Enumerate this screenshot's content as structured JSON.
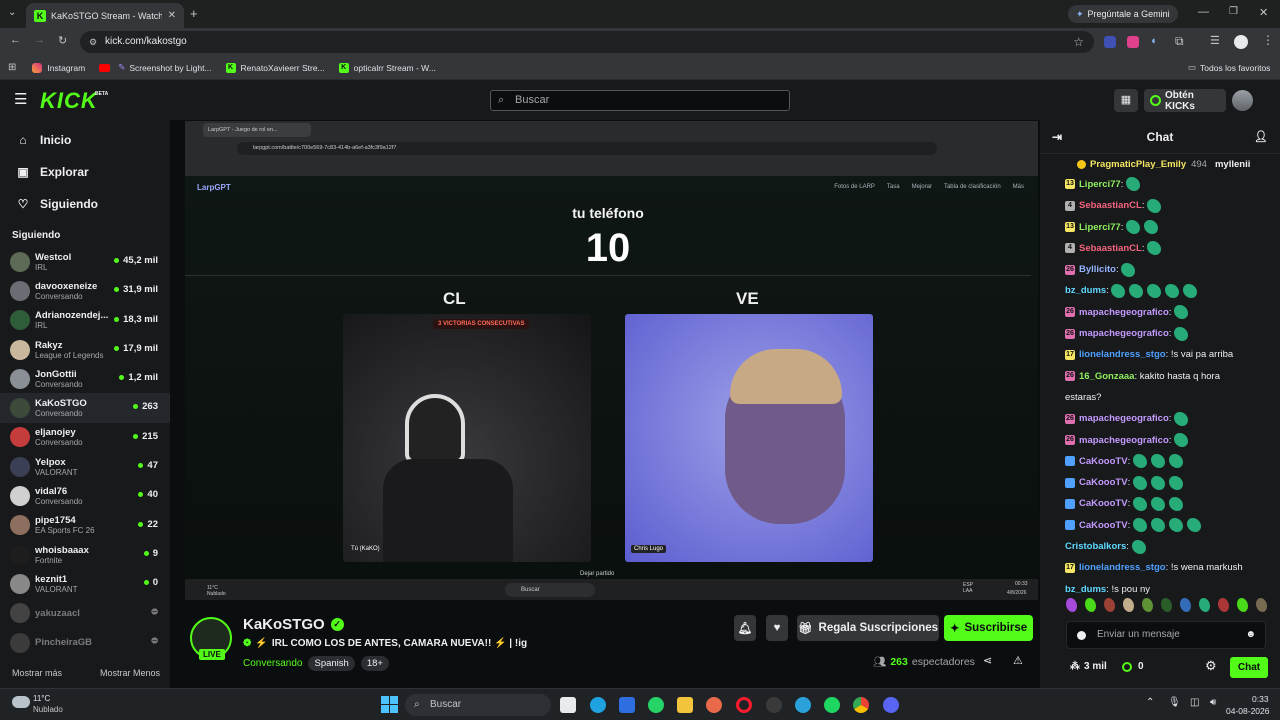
{
  "browser": {
    "tab_title": "KaKoSTGO Stream - Watch Live",
    "url": "kick.com/kakostgo",
    "gemini_label": "Pregúntale a Gemini",
    "bookmarks": [
      "Instagram",
      "Screenshot by Light...",
      "RenatoXavieerr Stre...",
      "opticalrr Stream - W..."
    ],
    "all_bookmarks": "Todos los favoritos"
  },
  "header": {
    "logo": "KICK",
    "beta": "BETA",
    "search_placeholder": "Buscar",
    "kicks_button": "Obtén KICKs"
  },
  "sidebar": {
    "nav": [
      {
        "label": "Inicio",
        "icon": "home-icon"
      },
      {
        "label": "Explorar",
        "icon": "compass-icon"
      },
      {
        "label": "Siguiendo",
        "icon": "heart-icon"
      }
    ],
    "following_heading": "Siguiendo",
    "following": [
      {
        "name": "Westcol",
        "category": "IRL",
        "viewers": "45,2 mil",
        "color": "#5b6b55"
      },
      {
        "name": "davooxeneize",
        "category": "Conversando",
        "viewers": "31,9 mil",
        "color": "#6a6e74"
      },
      {
        "name": "Adrianozendej...",
        "category": "IRL",
        "viewers": "18,3 mil",
        "color": "#2f5c3a"
      },
      {
        "name": "Rakyz",
        "category": "League of Legends",
        "viewers": "17,9 mil",
        "color": "#c9b89e"
      },
      {
        "name": "JonGottii",
        "category": "Conversando",
        "viewers": "1,2 mil",
        "color": "#8a8f96"
      },
      {
        "name": "KaKoSTGO",
        "category": "Conversando",
        "viewers": "263",
        "color": "#3d4a3a"
      },
      {
        "name": "eljanojey",
        "category": "Conversando",
        "viewers": "215",
        "color": "#c43c3c"
      },
      {
        "name": "Yelpox",
        "category": "VALORANT",
        "viewers": "47",
        "color": "#3a3f55"
      },
      {
        "name": "vidal76",
        "category": "Conversando",
        "viewers": "40",
        "color": "#d0d0d0"
      },
      {
        "name": "pipe1754",
        "category": "EA Sports FC 26",
        "viewers": "22",
        "color": "#8c6f5e"
      },
      {
        "name": "whoisbaaax",
        "category": "Fortnite",
        "viewers": "9",
        "color": "#1d1d1d"
      },
      {
        "name": "keznit1",
        "category": "VALORANT",
        "viewers": "0",
        "color": "#888888"
      },
      {
        "name": "yakuzaacl",
        "category": "",
        "viewers": "",
        "color": "#777777"
      },
      {
        "name": "PincheiraGB",
        "category": "",
        "viewers": "",
        "color": "#666666"
      }
    ],
    "show_more": "Mostrar más",
    "show_less": "Mostrar Menos"
  },
  "video": {
    "inner_tab": "LarpGPT - Juego de rol en...",
    "inner_url": "larpgpt.com/battle/c700e569-7c83-414b-a6ef-a3fc3f9a12f7",
    "site_name": "LarpGPT",
    "site_nav": [
      "Fotos de LARP",
      "Tasa",
      "Mejorar",
      "Tabla de clasificación",
      "Más"
    ],
    "your_phone": "tu teléfono",
    "count": "10",
    "left_team": "CL",
    "right_team": "VE",
    "streak": "3 VICTORIAS CONSECUTIVAS",
    "left_player": "Tú (KaKO)",
    "right_player": "Chris Lugo",
    "leave": "Dejar partido",
    "inner_weather": "11°C Nublado",
    "inner_search": "Buscar",
    "inner_lang": "ESP LAA",
    "inner_time": "00:33",
    "inner_date": "4/8/2026"
  },
  "stream": {
    "channel": "KaKoSTGO",
    "live_badge": "LIVE",
    "title": "IRL COMO LOS DE ANTES, CAMARA NUEVA!! ⚡ | !ig",
    "category": "Conversando",
    "tags": [
      "Spanish",
      "18+"
    ],
    "gift_button": "Regala Suscripciones",
    "subscribe_button": "Suscribirse",
    "viewers": "263",
    "viewers_label": "espectadores"
  },
  "chat": {
    "title": "Chat",
    "pinned_user": "PragmaticPlay_Emily",
    "pinned_count": "494",
    "pinned_user2": "myllenii",
    "messages": [
      {
        "badge": "13",
        "badge_color": "#f5e663",
        "user": "Liperci77",
        "color": "#8ef05e",
        "text": "",
        "emotes": 1
      },
      {
        "badge": "4",
        "badge_color": "#b0b0b0",
        "user": "SebaastianCL",
        "color": "#f4647f",
        "text": "",
        "emotes": 1
      },
      {
        "badge": "13",
        "badge_color": "#f5e663",
        "user": "Liperci77",
        "color": "#8ef05e",
        "text": "",
        "emotes": 2
      },
      {
        "badge": "4",
        "badge_color": "#b0b0b0",
        "user": "SebaastianCL",
        "color": "#f4647f",
        "text": "",
        "emotes": 1
      },
      {
        "badge": "26",
        "badge_color": "#e06fb0",
        "user": "Byllicito",
        "color": "#93b4ff",
        "text": "",
        "emotes": 1
      },
      {
        "badge": "",
        "badge_color": "",
        "user": "bz_dums",
        "color": "#5ed9ff",
        "text": "",
        "emotes": 5
      },
      {
        "badge": "26",
        "badge_color": "#e06fb0",
        "user": "mapachegeografico",
        "color": "#c49bff",
        "text": "",
        "emotes": 1
      },
      {
        "badge": "26",
        "badge_color": "#e06fb0",
        "user": "mapachegeografico",
        "color": "#c49bff",
        "text": "",
        "emotes": 1
      },
      {
        "badge": "17",
        "badge_color": "#f5e663",
        "user": "lionelandress_stgo",
        "color": "#4fa0ff",
        "text": "!s vai pa arriba",
        "emotes": 0
      },
      {
        "badge": "26",
        "badge_color": "#e06fb0",
        "user": "16_Gonzaaa",
        "color": "#8ef05e",
        "text": "kakito hasta q hora",
        "emotes": 0
      },
      {
        "badge": "",
        "badge_color": "",
        "user": "",
        "color": "#efeff1",
        "text": "estaras?",
        "emotes": 0
      },
      {
        "badge": "26",
        "badge_color": "#e06fb0",
        "user": "mapachegeografico",
        "color": "#c49bff",
        "text": "",
        "emotes": 1
      },
      {
        "badge": "26",
        "badge_color": "#e06fb0",
        "user": "mapachegeografico",
        "color": "#c49bff",
        "text": "",
        "emotes": 1
      },
      {
        "badge": "",
        "badge_color": "#4fa0ff",
        "user": "CaKoooTV",
        "color": "#c49bff",
        "text": "",
        "emotes": 3
      },
      {
        "badge": "",
        "badge_color": "#4fa0ff",
        "user": "CaKoooTV",
        "color": "#c49bff",
        "text": "",
        "emotes": 3
      },
      {
        "badge": "",
        "badge_color": "#4fa0ff",
        "user": "CaKoooTV",
        "color": "#c49bff",
        "text": "",
        "emotes": 3
      },
      {
        "badge": "",
        "badge_color": "#4fa0ff",
        "user": "CaKoooTV",
        "color": "#c49bff",
        "text": "",
        "emotes": 4
      },
      {
        "badge": "",
        "badge_color": "",
        "user": "Cristobalkors",
        "color": "#5ed9ff",
        "text": "",
        "emotes": 1
      },
      {
        "badge": "17",
        "badge_color": "#f5e663",
        "user": "lionelandress_stgo",
        "color": "#4fa0ff",
        "text": "!s wena markush",
        "emotes": 0
      },
      {
        "badge": "",
        "badge_color": "",
        "user": "bz_dums",
        "color": "#5ed9ff",
        "text": "!s pou ny",
        "emotes": 0
      }
    ],
    "input_placeholder": "Enviar un mensaje",
    "points": "3 mil",
    "kicks": "0",
    "send_button": "Chat"
  },
  "taskbar": {
    "weather_temp": "11°C",
    "weather_text": "Nublado",
    "search": "Buscar",
    "time": "0:33",
    "date": "04-08-2026"
  }
}
